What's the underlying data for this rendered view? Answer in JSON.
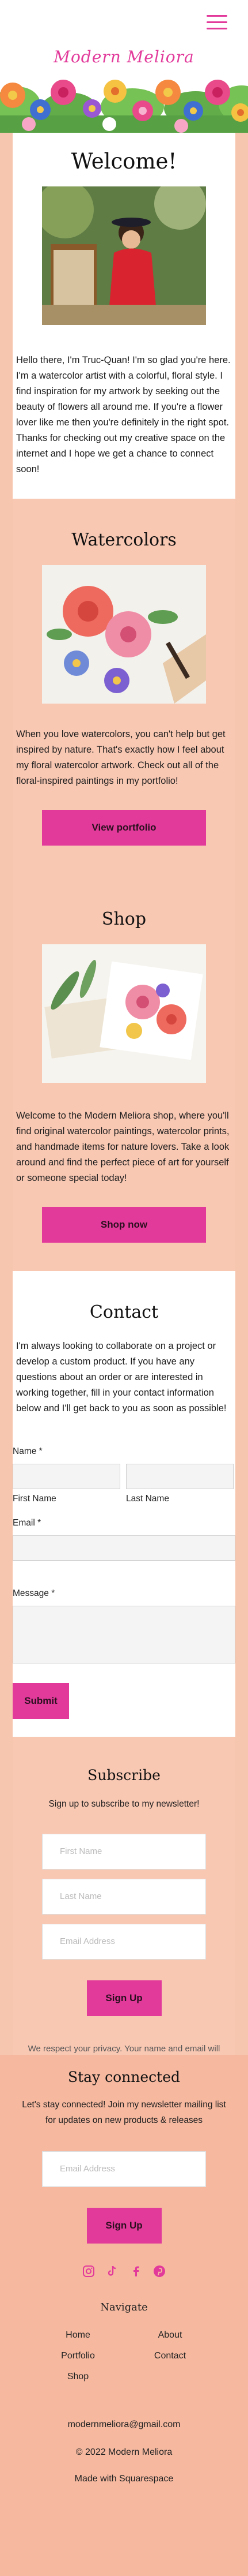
{
  "header": {
    "logo_text": "Modern Meliora",
    "menu_icon": "hamburger-menu-icon",
    "accent_color": "#e23a9b"
  },
  "welcome": {
    "title": "Welcome!",
    "body": "Hello there, I'm Truc-Quan! I'm so glad you're here. I'm a watercolor artist with a colorful, floral style. I find inspiration for my artwork by seeking out the beauty of flowers all around me. If you're a flower lover like me then you're definitely in the right spot. Thanks for checking out my creative space on the internet and I hope we get a chance to connect soon!"
  },
  "watercolors": {
    "title": "Watercolors",
    "body": "When you love watercolors, you can't help but get inspired by nature. That's exactly how I feel about my floral watercolor artwork. Check out all of the floral-inspired paintings in my portfolio!",
    "button": "View portfolio"
  },
  "shop": {
    "title": "Shop",
    "body": "Welcome to the Modern Meliora shop, where you'll find original watercolor paintings, watercolor prints, and handmade items for nature lovers. Take a look around and find the perfect piece of art for yourself or someone special today!",
    "button": "Shop now"
  },
  "contact": {
    "title": "Contact",
    "intro": "I'm always looking to collaborate on a project or develop a custom product. If you have any questions about an order or are interested in working together, fill in your contact information below and I'll get back to you as soon as possible!",
    "name_label": "Name *",
    "first_name_label": "First Name",
    "last_name_label": "Last Name",
    "email_label": "Email *",
    "message_label": "Message *",
    "submit": "Submit"
  },
  "subscribe": {
    "title": "Subscribe",
    "subtitle": "Sign up to subscribe to my newsletter!",
    "first_name_placeholder": "First Name",
    "last_name_placeholder": "Last Name",
    "email_placeholder": "Email Address",
    "button": "Sign Up",
    "privacy": "We respect your privacy. Your name and email will not be released to third-parties."
  },
  "connect": {
    "title": "Stay connected",
    "subtitle": "Let's stay connected! Join my newsletter mailing list for updates on new products & releases",
    "email_placeholder": "Email Address",
    "button": "Sign Up",
    "social": [
      "instagram-icon",
      "tiktok-icon",
      "facebook-icon",
      "pinterest-icon"
    ]
  },
  "footer": {
    "nav_title": "Navigate",
    "nav_left": [
      "Home",
      "Portfolio",
      "Shop"
    ],
    "nav_right": [
      "About",
      "Contact"
    ],
    "email": "modernmeliora@gmail.com",
    "copyright": "© 2022 Modern Meliora",
    "made_with": "Made with Squarespace"
  }
}
